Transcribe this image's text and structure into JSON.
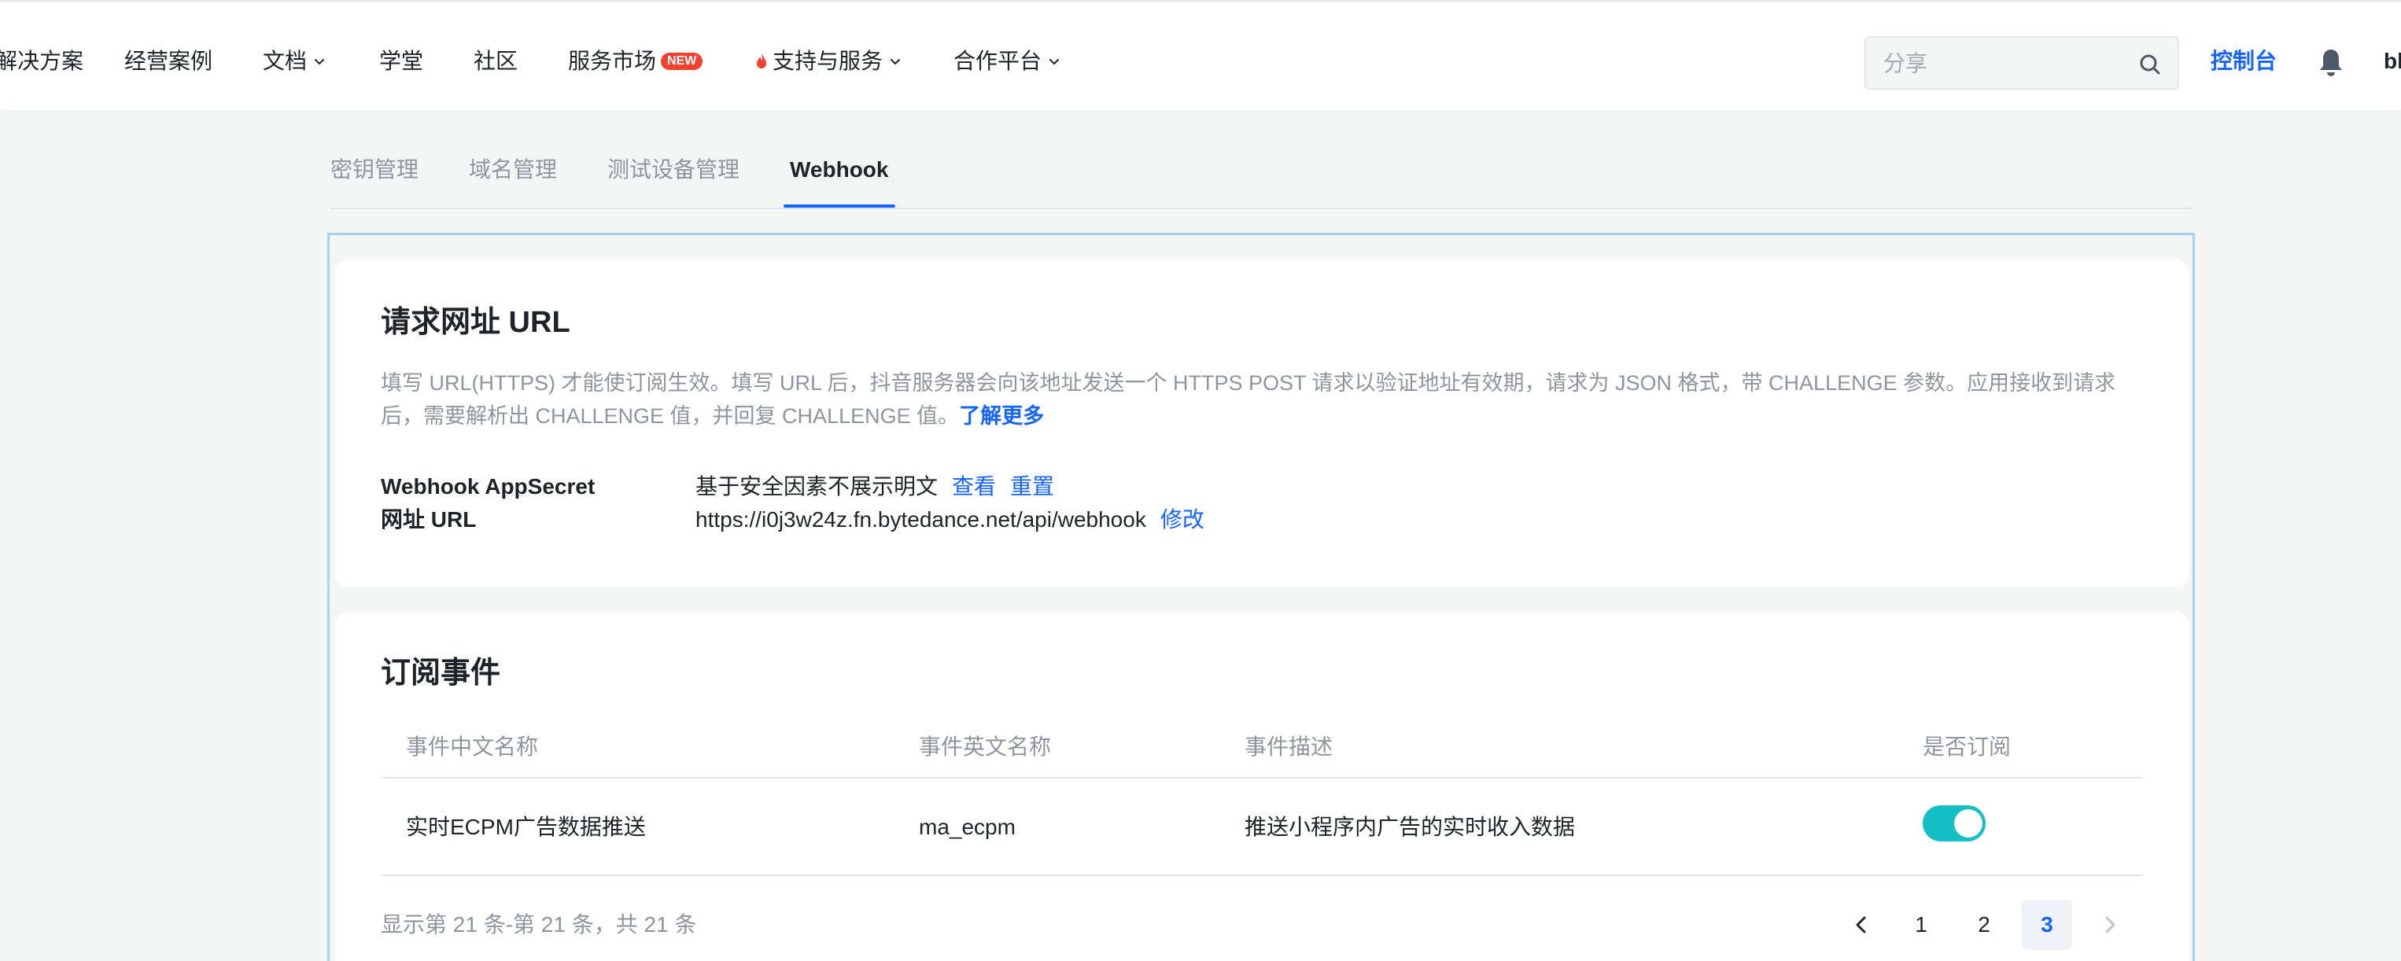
{
  "nav": {
    "items": [
      {
        "label": "解决方案",
        "has_dropdown": false
      },
      {
        "label": "经营案例",
        "has_dropdown": false
      },
      {
        "label": "文档",
        "has_dropdown": true
      },
      {
        "label": "学堂",
        "has_dropdown": false
      },
      {
        "label": "社区",
        "has_dropdown": false
      },
      {
        "label": "服务市场",
        "badge": "NEW",
        "has_dropdown": false
      },
      {
        "label": "支持与服务",
        "has_dropdown": true,
        "icon": "fire-icon"
      },
      {
        "label": "合作平台",
        "has_dropdown": true
      }
    ],
    "search_placeholder": "分享",
    "console_label": "控制台",
    "user_name": "bl"
  },
  "tabs": [
    {
      "label": "密钥管理",
      "active": false
    },
    {
      "label": "域名管理",
      "active": false
    },
    {
      "label": "测试设备管理",
      "active": false
    },
    {
      "label": "Webhook",
      "active": true
    }
  ],
  "url_card": {
    "title": "请求网址 URL",
    "description": "填写 URL(HTTPS) 才能使订阅生效。填写 URL 后，抖音服务器会向该地址发送一个 HTTPS POST 请求以验证地址有效期，请求为 JSON 格式，带 CHALLENGE 参数。应用接收到请求后，需要解析出 CHALLENGE 值，并回复 CHALLENGE 值。",
    "learn_more": "了解更多",
    "secret_label": "Webhook AppSecret",
    "secret_value": "基于安全因素不展示明文",
    "view_link": "查看",
    "reset_link": "重置",
    "url_label": "网址 URL",
    "url_value": "https://i0j3w24z.fn.bytedance.net/api/webhook",
    "edit_link": "修改"
  },
  "events_card": {
    "title": "订阅事件",
    "columns": [
      "事件中文名称",
      "事件英文名称",
      "事件描述",
      "是否订阅"
    ],
    "rows": [
      {
        "cn_name": "实时ECPM广告数据推送",
        "en_name": "ma_ecpm",
        "description": "推送小程序内广告的实时收入数据",
        "subscribed": true
      }
    ],
    "pagination": {
      "info": "显示第 21 条-第 21 条，共 21 条",
      "pages": [
        "1",
        "2",
        "3"
      ],
      "current": "3"
    }
  },
  "colors": {
    "accent": "#1664ff",
    "toggle_on": "#14c0c6",
    "badge_red": "#f5402f",
    "panel_border": "#a3d2f5"
  }
}
